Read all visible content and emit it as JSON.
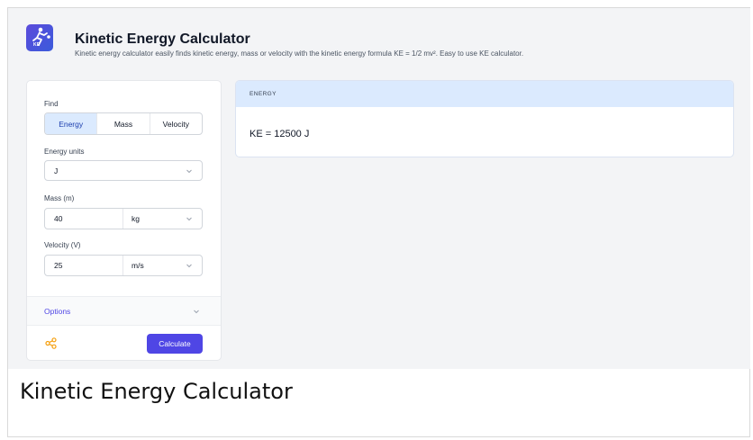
{
  "header": {
    "title": "Kinetic Energy Calculator",
    "subtitle": "Kinetic energy calculator easily finds kinetic energy, mass or velocity with the kinetic energy formula KE = 1/2 mv². Easy to use KE calculator.",
    "icon": "running-person-icon",
    "icon_tag": "KE"
  },
  "form": {
    "find_label": "Find",
    "find_options": [
      "Energy",
      "Mass",
      "Velocity"
    ],
    "find_selected": "Energy",
    "energy_units_label": "Energy units",
    "energy_units_value": "J",
    "mass_label": "Mass (m)",
    "mass_value": "40",
    "mass_unit": "kg",
    "velocity_label": "Velocity (V)",
    "velocity_value": "25",
    "velocity_unit": "m/s",
    "options_label": "Options",
    "calculate_label": "Calculate",
    "share_icon": "share-icon"
  },
  "result": {
    "header": "ENERGY",
    "value": "KE = 12500 J"
  },
  "caption": "Kinetic Energy Calculator",
  "colors": {
    "accent": "#4f46e5",
    "active_tab_bg": "#dbeafe",
    "result_header_bg": "#dbeafe",
    "share_icon": "#f59e0b",
    "background": "#f3f4f6"
  }
}
